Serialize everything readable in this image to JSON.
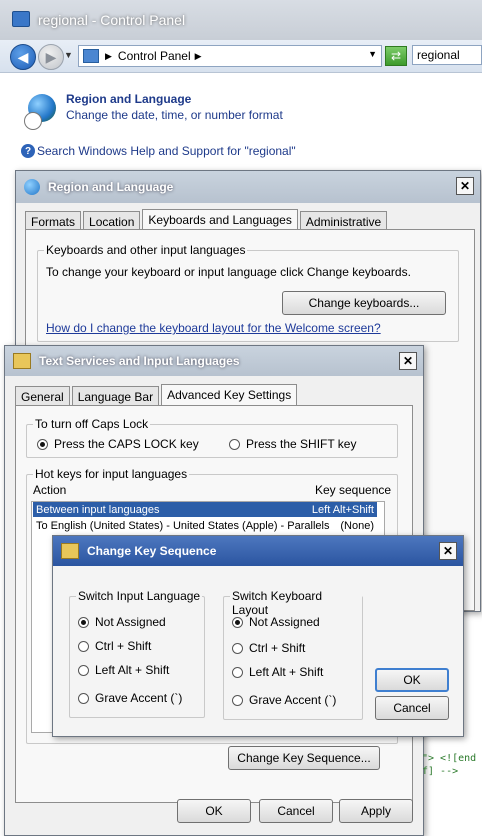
{
  "control_panel": {
    "window_title": "regional - Control Panel",
    "breadcrumb": "Control Panel",
    "search_value": "regional",
    "result": {
      "title": "Region and Language",
      "subtitle": "Change the date, time, or number format"
    },
    "help_link": "Search Windows Help and Support for \"regional\""
  },
  "region_dialog": {
    "title": "Region and Language",
    "tabs": [
      "Formats",
      "Location",
      "Keyboards and Languages",
      "Administrative"
    ],
    "active_tab": "Keyboards and Languages",
    "group_label": "Keyboards and other input languages",
    "instruction": "To change your keyboard or input language click Change keyboards.",
    "change_keyboards_button": "Change keyboards...",
    "welcome_link": "How do I change the keyboard layout for the Welcome screen?"
  },
  "text_services_dialog": {
    "title": "Text Services and Input Languages",
    "tabs": [
      "General",
      "Language Bar",
      "Advanced Key Settings"
    ],
    "active_tab": "Advanced Key Settings",
    "caps_group": "To turn off Caps Lock",
    "caps_options": [
      "Press the CAPS LOCK key",
      "Press the SHIFT key"
    ],
    "caps_selected": "Press the CAPS LOCK key",
    "hotkeys_group": "Hot keys for input languages",
    "columns": [
      "Action",
      "Key sequence"
    ],
    "rows": [
      {
        "action": "Between input languages",
        "sequence": "Left Alt+Shift",
        "selected": true
      },
      {
        "action": "To English (United States) - United States (Apple) - Parallels",
        "sequence": "(None)",
        "selected": false
      }
    ],
    "change_key_sequence_button": "Change Key Sequence...",
    "ok_button": "OK",
    "cancel_button": "Cancel",
    "apply_button": "Apply"
  },
  "change_key_dialog": {
    "title": "Change Key Sequence",
    "input_group": "Switch Input Language",
    "input_options": [
      "Not Assigned",
      "Ctrl + Shift",
      "Left Alt + Shift",
      "Grave Accent (`)"
    ],
    "input_selected": "Not Assigned",
    "layout_group": "Switch Keyboard Layout",
    "layout_options": [
      "Not Assigned",
      "Ctrl + Shift",
      "Left Alt + Shift",
      "Grave Accent (`)"
    ],
    "layout_selected": "Not Assigned",
    "ok_button": "OK",
    "cancel_button": "Cancel"
  },
  "background_code": [
    "\"> <![end",
    "f] -->"
  ]
}
